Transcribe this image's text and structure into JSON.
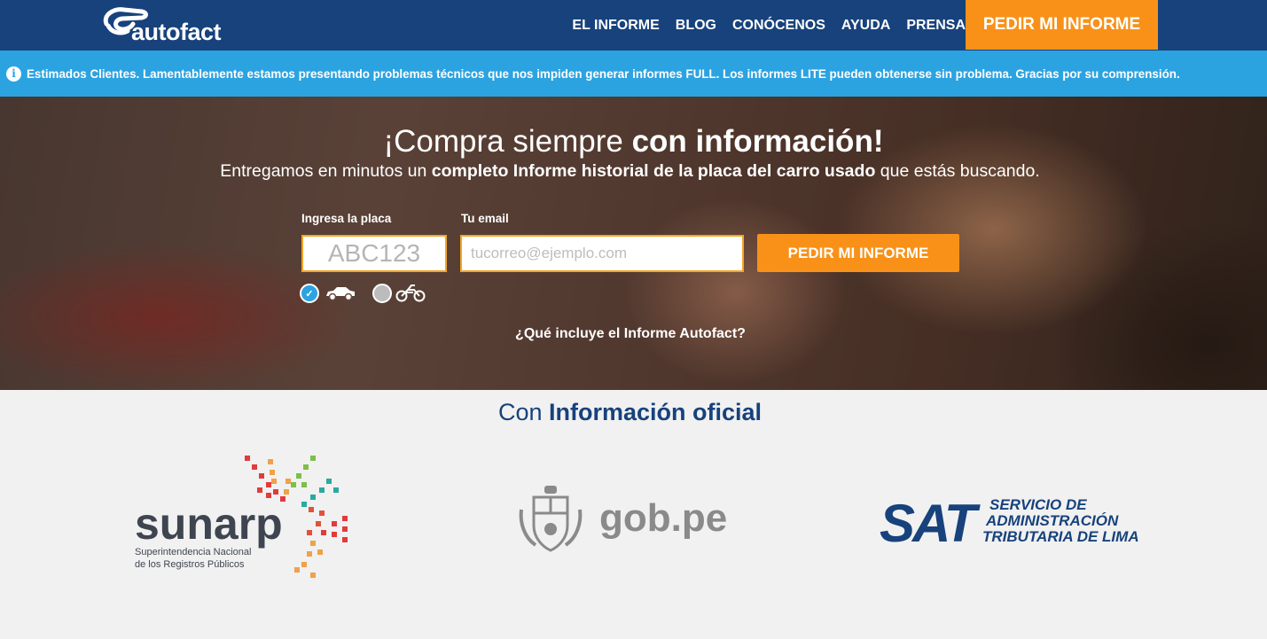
{
  "header": {
    "brand": "autofact",
    "nav": [
      "EL INFORME",
      "BLOG",
      "CONÓCENOS",
      "AYUDA",
      "PRENSA"
    ],
    "cta": "PEDIR MI INFORME"
  },
  "alert": {
    "icon": "info-icon",
    "message": "Estimados Clientes. Lamentablemente estamos presentando problemas técnicos que nos impiden generar informes FULL. Los informes LITE pueden obtenerse sin problema. Gracias por su comprensión."
  },
  "hero": {
    "title_regular": "¡Compra siempre ",
    "title_bold": "con información!",
    "sub_before": "Entregamos en minutos un ",
    "sub_bold": "completo Informe historial de la placa del carro usado",
    "sub_after": " que estás buscando.",
    "plate_label": "Ingresa la placa",
    "plate_placeholder": "ABC123",
    "email_label": "Tu email",
    "email_placeholder": "tucorreo@ejemplo.com",
    "submit": "PEDIR MI INFORME",
    "vehicle_options": [
      {
        "icon": "car-icon",
        "selected": true
      },
      {
        "icon": "motorcycle-icon",
        "selected": false
      }
    ],
    "more_link": "¿Qué incluye el Informe Autofact?"
  },
  "official": {
    "title_regular": "Con ",
    "title_bold": "Información oficial",
    "logos": {
      "sunarp": {
        "name": "sunarp",
        "line1": "Superintendencia Nacional",
        "line2": "de los Registros Públicos"
      },
      "gob": {
        "name": "gob.pe"
      },
      "sat": {
        "name": "SAT",
        "line1": "SERVICIO DE",
        "line2": "ADMINISTRACIÓN",
        "line3": "TRIBUTARIA DE LIMA"
      }
    }
  },
  "colors": {
    "header_bg": "#17427c",
    "accent_orange": "#f99119",
    "alert_blue": "#2ca3e1",
    "section_bg": "#f1f1f1"
  }
}
